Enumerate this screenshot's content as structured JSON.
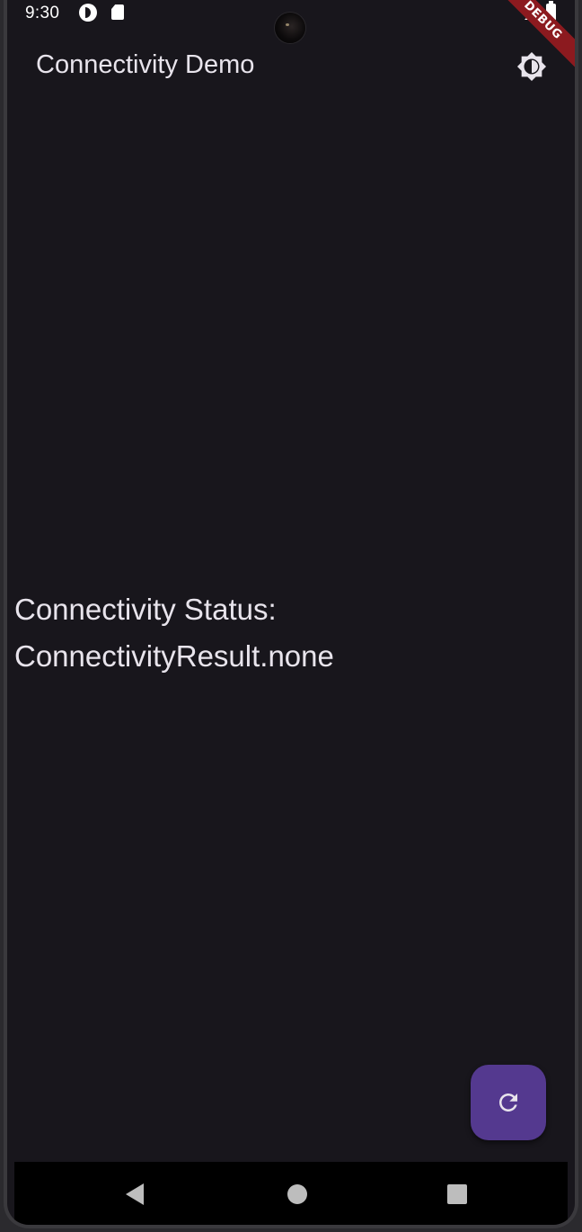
{
  "status_bar": {
    "time": "9:30",
    "icons": [
      "app-notification-icon",
      "sd-card-icon",
      "signal-icon",
      "battery-icon"
    ]
  },
  "debug_banner": "DEBUG",
  "app_bar": {
    "title": "Connectivity Demo",
    "action_icon": "brightness-icon"
  },
  "main": {
    "status_label": "Connectivity Status:",
    "status_value": "ConnectivityResult.none"
  },
  "fab": {
    "icon": "refresh-icon"
  },
  "navigation": {
    "buttons": [
      "back",
      "home",
      "recents"
    ]
  },
  "colors": {
    "background": "#18161c",
    "text": "#e8e4ec",
    "fab": "#54398f",
    "debug_banner": "#8c1a1f"
  }
}
